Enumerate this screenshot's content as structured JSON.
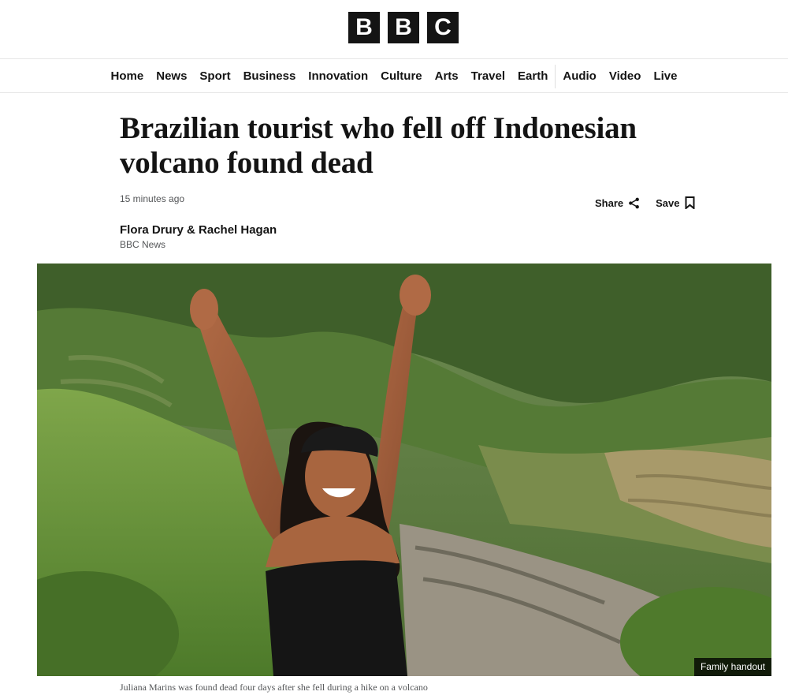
{
  "brand": {
    "letters": [
      "B",
      "B",
      "C"
    ]
  },
  "nav": {
    "items": [
      "Home",
      "News",
      "Sport",
      "Business",
      "Innovation",
      "Culture",
      "Arts",
      "Travel",
      "Earth",
      "Audio",
      "Video",
      "Live"
    ]
  },
  "article": {
    "headline_line1": "Brazilian tourist who fell off Indonesian",
    "headline_line2": "volcano found dead",
    "timestamp": "15 minutes ago",
    "share_label": "Share",
    "save_label": "Save",
    "byline_names": "Flora Drury & Rachel Hagan",
    "byline_org": "BBC News",
    "image_credit": "Family handout",
    "caption": "Juliana Marins was found dead four days after she fell during a hike on a volcano"
  },
  "colors": {
    "text": "#141414",
    "muted": "#545658",
    "logo_bg": "#141414"
  },
  "icons": {
    "share": "share-icon",
    "save": "bookmark-icon"
  }
}
